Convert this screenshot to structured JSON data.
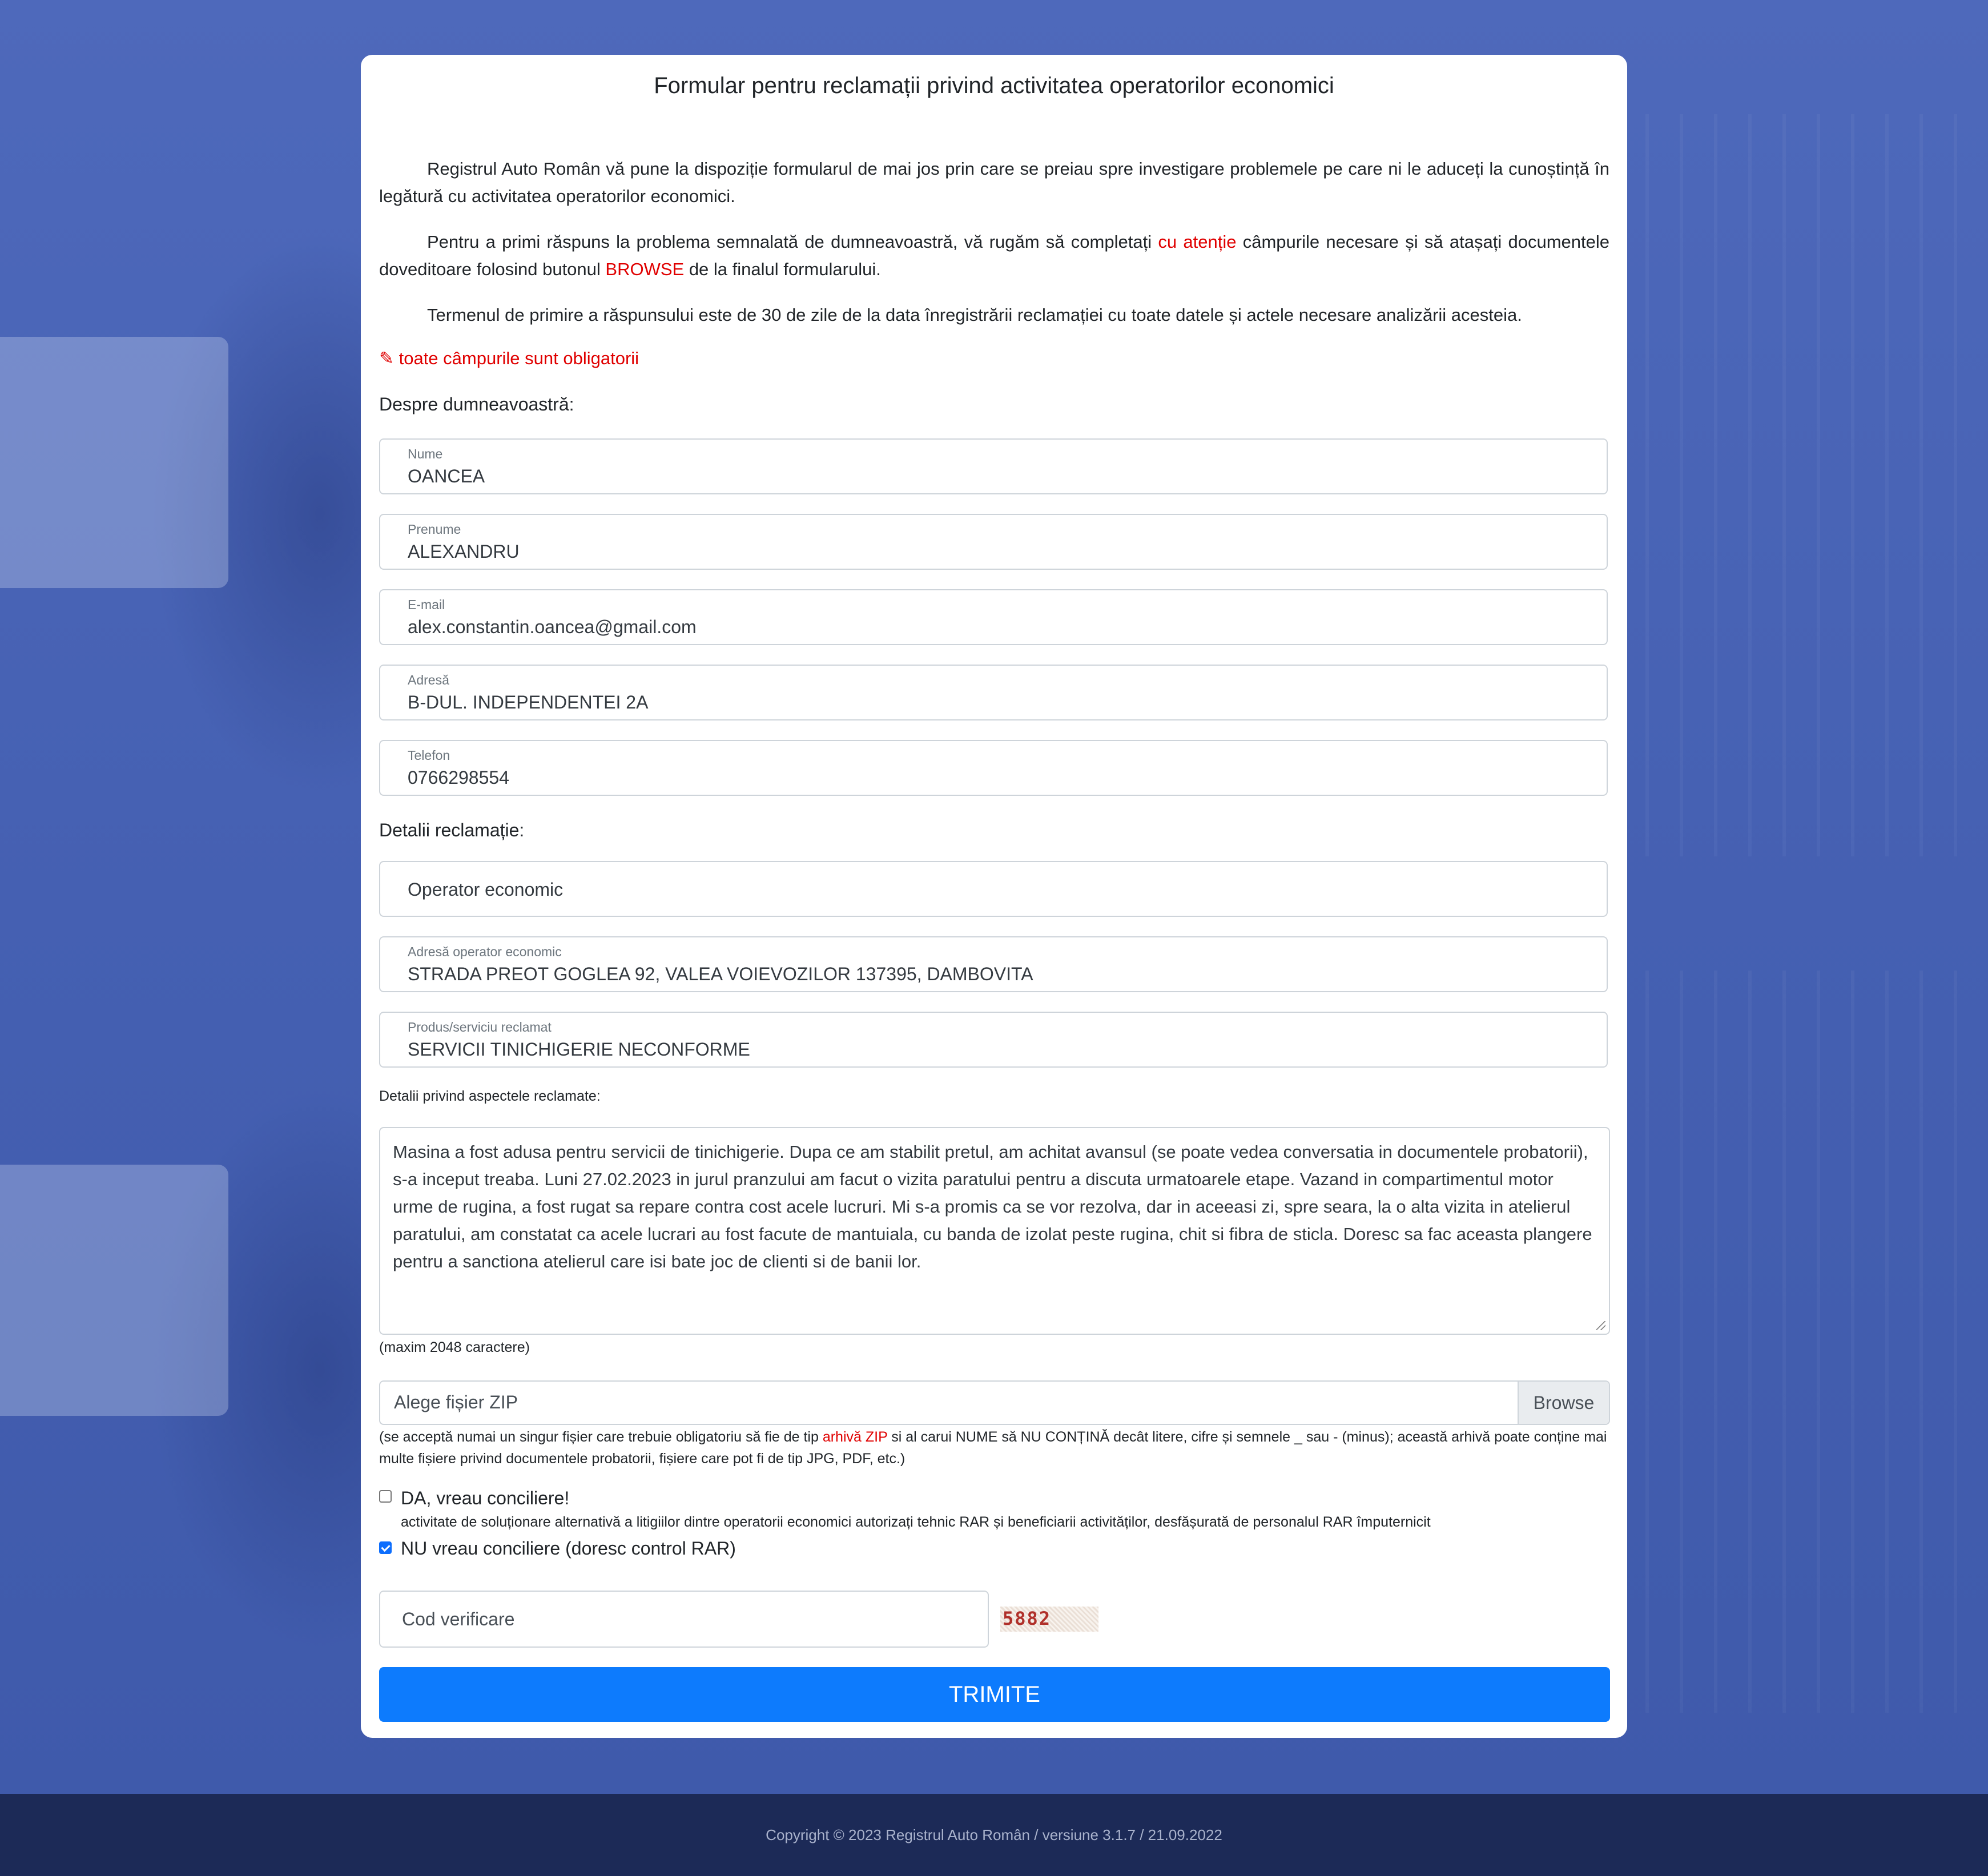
{
  "title": "Formular pentru reclamații privind activitatea operatorilor economici",
  "intro": {
    "p1": "Registrul Auto Român vă pune la dispoziție formularul de mai jos prin care se preiau spre investigare problemele pe care ni le aduceți la cunoștință în legătură cu activitatea operatorilor economici.",
    "p2_before": "Pentru a primi răspuns la problema semnalată de dumneavoastră, vă rugăm să completați ",
    "p2_red1": "cu atenție",
    "p2_middle": " câmpurile necesare și să atașați documentele doveditoare folosind butonul ",
    "p2_red2": "BROWSE",
    "p2_after": " de la finalul formularului.",
    "p3": "Termenul de primire a răspunsului este de 30 de zile de la data înregistrării reclamației cu toate datele și actele necesare analizării acesteia."
  },
  "required_note": "✎ toate câmpurile sunt obligatorii",
  "section_about": "Despre dumneavoastră:",
  "fields": {
    "nume": {
      "label": "Nume",
      "value": "OANCEA"
    },
    "prenume": {
      "label": "Prenume",
      "value": "ALEXANDRU"
    },
    "email": {
      "label": "E-mail",
      "value": "alex.constantin.oancea@gmail.com"
    },
    "adresa": {
      "label": "Adresă",
      "value": "B-DUL. INDEPENDENTEI 2A"
    },
    "telefon": {
      "label": "Telefon",
      "value": "0766298554"
    }
  },
  "section_details": "Detalii reclamație:",
  "operator_select": "Operator economic",
  "operator_address": {
    "label": "Adresă operator economic",
    "value": "STRADA PREOT GOGLEA 92, VALEA VOIEVOZILOR 137395, DAMBOVITA"
  },
  "product": {
    "label": "Produs/serviciu reclamat",
    "value": "SERVICII TINICHIGERIE NECONFORME"
  },
  "details_label": "Detalii privind aspectele reclamate:",
  "details_text": "Masina a fost adusa pentru servicii de tinichigerie. Dupa ce am stabilit pretul, am achitat avansul (se poate vedea conversatia in documentele probatorii), s-a inceput treaba. Luni 27.02.2023 in jurul pranzului am facut o vizita paratului pentru a discuta urmatoarele etape. Vazand in compartimentul motor urme de rugina, a fost rugat sa repare contra cost acele lucruri. Mi s-a promis ca se vor rezolva, dar in aceeasi zi, spre seara, la o alta vizita in atelierul paratului, am constatat ca acele lucrari au fost facute de mantuiala, cu banda de izolat peste rugina, chit si fibra de sticla. Doresc sa fac aceasta plangere pentru a sanctiona atelierul care isi bate joc de clienti si de banii lor.",
  "max_chars": "(maxim 2048 caractere)",
  "file": {
    "placeholder": "Alege fișier ZIP",
    "browse": "Browse",
    "help_before": "(se acceptă numai un singur fișier care trebuie obligatoriu să fie de tip ",
    "help_red": "arhivă ZIP",
    "help_after": " si al carui NUME să NU CONȚINĂ decât litere, cifre și semnele _ sau - (minus); această arhivă poate conține mai multe fișiere privind documentele probatorii, fișiere care pot fi de tip JPG, PDF, etc.)"
  },
  "conciliere": {
    "da_label": "DA, vreau conciliere!",
    "da_checked": false,
    "da_desc": "activitate de soluționare alternativă a litigiilor dintre operatorii economici autorizați tehnic RAR și beneficiarii activităților, desfășurată de personalul RAR împuternicit",
    "nu_label": "NU vreau conciliere (doresc control RAR)",
    "nu_checked": true
  },
  "verification": {
    "placeholder": "Cod verificare",
    "captcha": "5882"
  },
  "submit": "TRIMITE",
  "footer": "Copyright © 2023 Registrul Auto Român / versiune 3.1.7 / 21.09.2022",
  "colors": {
    "accent": "#0d7bfd",
    "required": "#e00000",
    "background": "#4762b4",
    "footer": "#1c2a57"
  }
}
